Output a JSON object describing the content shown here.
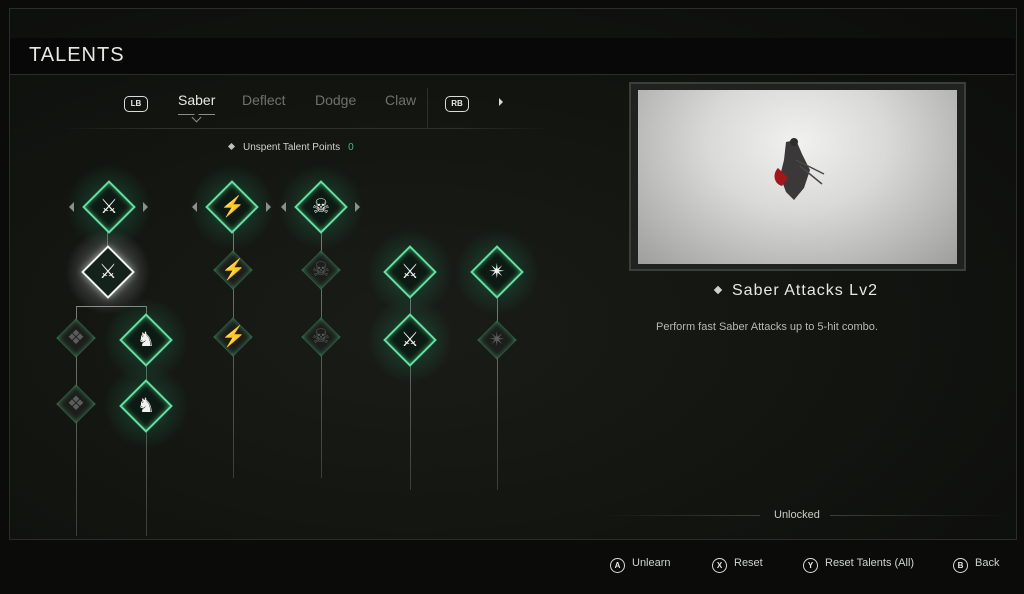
{
  "header": {
    "title": "TALENTS"
  },
  "tabs": {
    "prev_button": "LB",
    "next_button": "RB",
    "items": [
      {
        "label": "Saber",
        "active": true
      },
      {
        "label": "Deflect",
        "active": false
      },
      {
        "label": "Dodge",
        "active": false
      },
      {
        "label": "Claw",
        "active": false
      }
    ]
  },
  "points": {
    "label": "Unspent Talent Points",
    "value": "0"
  },
  "talent_tree": {
    "nodes": [
      {
        "icon": "scythe-slash-icon",
        "state": "unlocked"
      },
      {
        "icon": "claw-strike-icon",
        "state": "unlocked"
      },
      {
        "icon": "skull-sword-icon",
        "state": "unlocked"
      },
      {
        "icon": "scythe-slash-icon",
        "state": "selected"
      },
      {
        "icon": "claw-strike-icon",
        "state": "locked"
      },
      {
        "icon": "skull-sword-icon",
        "state": "locked"
      },
      {
        "icon": "saber-icon",
        "state": "unlocked"
      },
      {
        "icon": "pinwheel-icon",
        "state": "unlocked"
      },
      {
        "icon": "crow-icon",
        "state": "locked"
      },
      {
        "icon": "reaper-icon",
        "state": "unlocked"
      },
      {
        "icon": "claw-strike-icon",
        "state": "locked"
      },
      {
        "icon": "skull-sword-icon",
        "state": "locked"
      },
      {
        "icon": "saber-icon",
        "state": "unlocked"
      },
      {
        "icon": "pinwheel-icon",
        "state": "locked"
      },
      {
        "icon": "crow-icon",
        "state": "locked"
      },
      {
        "icon": "reaper-icon",
        "state": "unlocked"
      }
    ],
    "accent_color": "#5fe0a0"
  },
  "detail": {
    "name": "Saber Attacks Lv2",
    "description": "Perform fast Saber Attacks up to 5-hit combo.",
    "status": "Unlocked"
  },
  "footer": {
    "hints": [
      {
        "button": "A",
        "label": "Unlearn"
      },
      {
        "button": "X",
        "label": "Reset"
      },
      {
        "button": "Y",
        "label": "Reset Talents (All)"
      },
      {
        "button": "B",
        "label": "Back"
      }
    ]
  }
}
